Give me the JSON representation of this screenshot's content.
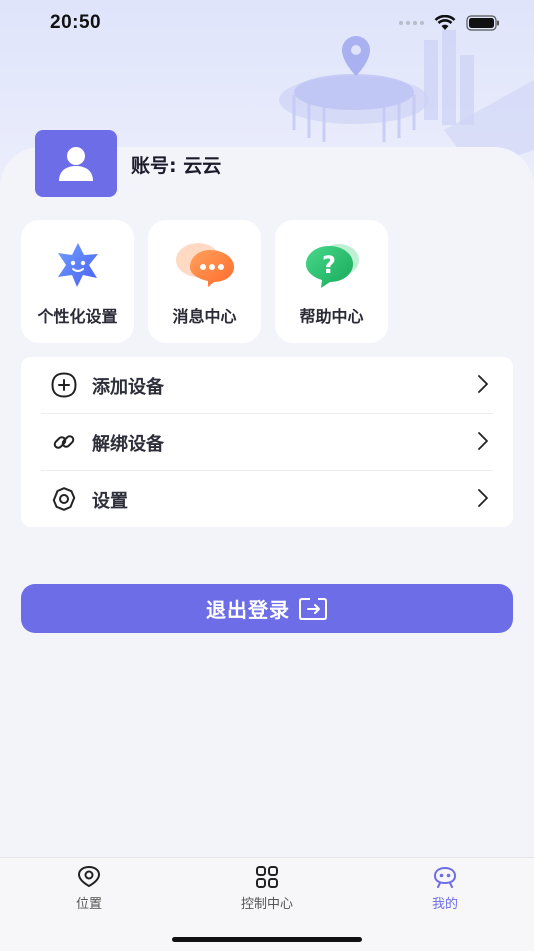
{
  "status": {
    "time": "20:50"
  },
  "profile": {
    "account_text": "账号: 云云"
  },
  "tiles": [
    {
      "label": "个性化设置",
      "icon": "star-face-icon"
    },
    {
      "label": "消息中心",
      "icon": "chat-bubbles-icon"
    },
    {
      "label": "帮助中心",
      "icon": "question-bubble-icon"
    }
  ],
  "menu": [
    {
      "label": "添加设备",
      "icon": "plus-circle-icon"
    },
    {
      "label": "解绑设备",
      "icon": "unlink-icon"
    },
    {
      "label": "设置",
      "icon": "gear-icon"
    }
  ],
  "logout_label": "退出登录",
  "tabs": [
    {
      "label": "位置",
      "icon": "location-icon",
      "active": false
    },
    {
      "label": "控制中心",
      "icon": "grid-icon",
      "active": false
    },
    {
      "label": "我的",
      "icon": "robot-face-icon",
      "active": true
    }
  ],
  "colors": {
    "accent": "#6d6ee7",
    "background": "#f3f4f9"
  }
}
